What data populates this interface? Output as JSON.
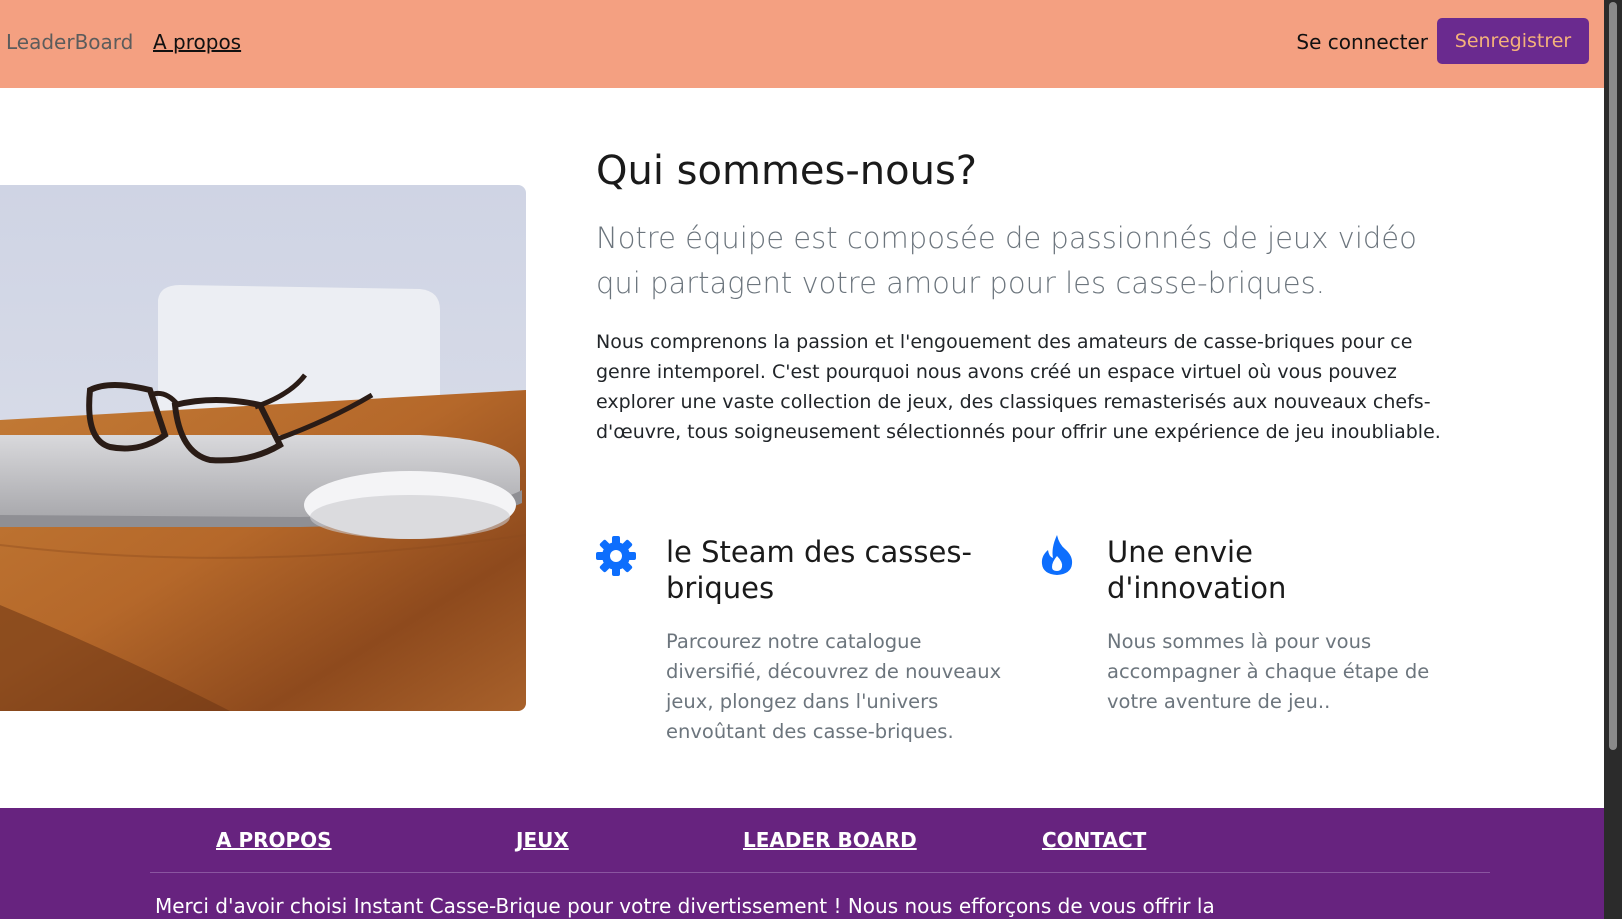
{
  "navbar": {
    "brand": "LeaderBoard",
    "about_link": "A propos",
    "login_link": "Se connecter",
    "register_button": "Senregistrer"
  },
  "hero": {
    "image_icon": "desk-laptop-glasses-photo"
  },
  "about": {
    "title": "Qui sommes-nous?",
    "lead": "Notre équipe est composée de passionnés de jeux vidéo qui partagent votre amour pour les casse-briques.",
    "body": "Nous comprenons la passion et l'engouement des amateurs de casse-briques pour ce genre intemporel. C'est pourquoi nous avons créé un espace virtuel où vous pouvez explorer une vaste collection de jeux, des classiques remasterisés aux nouveaux chefs-d'œuvre, tous soigneusement sélectionnés pour offrir une expérience de jeu inoubliable."
  },
  "features": [
    {
      "icon": "gear-icon",
      "title": "le Steam des casses-briques",
      "text": "Parcourez notre catalogue diversifié, découvrez de nouveaux jeux, plongez dans l'univers envoûtant des casse-briques."
    },
    {
      "icon": "fire-icon",
      "title": "Une envie d'innovation",
      "text": "Nous sommes là pour vous accompagner à chaque étape de votre aventure de jeu.."
    }
  ],
  "footer": {
    "links": [
      "A PROPOS",
      "JEUX",
      "LEADER BOARD",
      "CONTACT"
    ],
    "text": "Merci d'avoir choisi Instant Casse-Brique pour votre divertissement ! Nous nous efforçons de vous offrir la"
  },
  "colors": {
    "navbar_bg": "#f4a081",
    "accent_purple": "#6a2a8f",
    "footer_bg": "#67237f",
    "icon_blue": "#0d6efd"
  }
}
